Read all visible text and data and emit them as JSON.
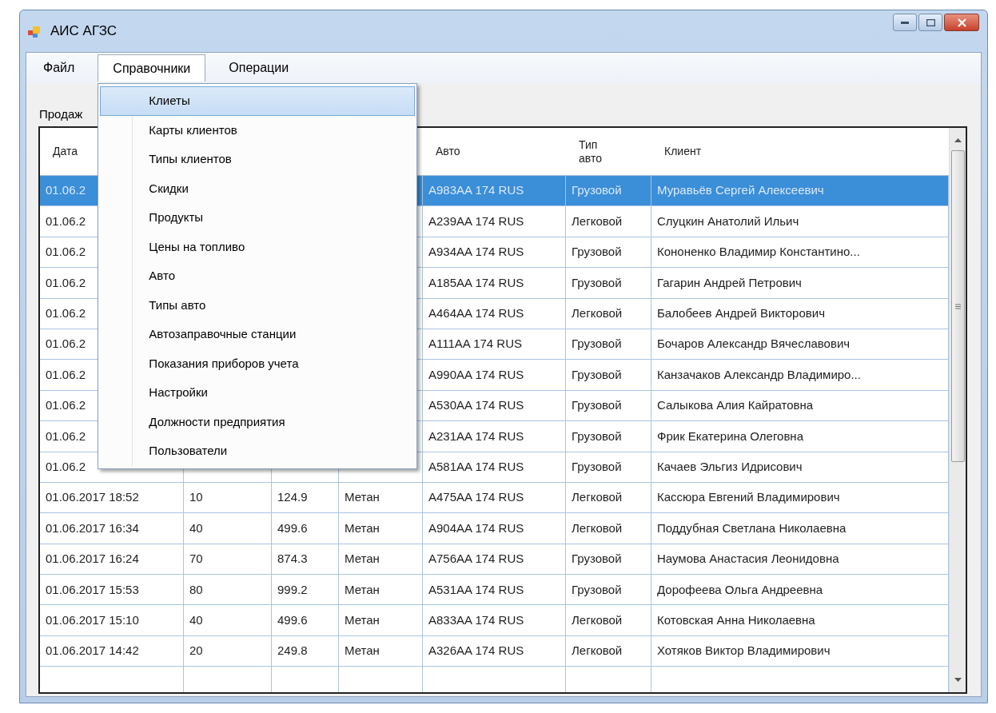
{
  "window": {
    "title": "АИС АГЗС"
  },
  "menu": [
    {
      "label": "Файл",
      "selected": false
    },
    {
      "label": "Справочники",
      "selected": true
    },
    {
      "label": "Операции",
      "selected": false
    }
  ],
  "dropdown": [
    {
      "label": "Клиеты",
      "selected": true
    },
    {
      "label": "Карты клиентов",
      "selected": false
    },
    {
      "label": "Типы клиентов",
      "selected": false
    },
    {
      "label": "Скидки",
      "selected": false
    },
    {
      "label": "Продукты",
      "selected": false
    },
    {
      "label": "Цены на топливо",
      "selected": false
    },
    {
      "label": "Авто",
      "selected": false
    },
    {
      "label": "Типы авто",
      "selected": false
    },
    {
      "label": "Автозаправочные станции",
      "selected": false
    },
    {
      "label": "Показания приборов учета",
      "selected": false
    },
    {
      "label": "Настройки",
      "selected": false
    },
    {
      "label": "Должности предприятия",
      "selected": false
    },
    {
      "label": "Пользователи",
      "selected": false
    }
  ],
  "section_label": "Продаж",
  "table": {
    "columns": {
      "date": "Дата",
      "car": "Авто",
      "car_type": "Тип авто",
      "client": "Клиент"
    },
    "rows": [
      {
        "date": "01.06.2",
        "car": "A983AA 174 RUS",
        "car_type": "Грузовой",
        "client": "Муравьёв Сергей Алексеевич",
        "selected": true
      },
      {
        "date": "01.06.2",
        "car": "A239AA 174 RUS",
        "car_type": "Легковой",
        "client": "Слуцкин Анатолий Ильич",
        "selected": false
      },
      {
        "date": "01.06.2",
        "car": "A934AA 174 RUS",
        "car_type": "Грузовой",
        "client": "Кононенко Владимир Константино...",
        "selected": false
      },
      {
        "date": "01.06.2",
        "car": "A185AA 174 RUS",
        "car_type": "Грузовой",
        "client": "Гагарин Андрей Петрович",
        "selected": false
      },
      {
        "date": "01.06.2",
        "car": "A464AA 174 RUS",
        "car_type": "Легковой",
        "client": "Балобеев Андрей Викторович",
        "selected": false
      },
      {
        "date": "01.06.2",
        "car": "A111AA 174 RUS",
        "car_type": "Грузовой",
        "client": "Бочаров Александр Вячеславович",
        "selected": false
      },
      {
        "date": "01.06.2",
        "car": "A990AA 174 RUS",
        "car_type": "Грузовой",
        "client": "Канзачаков Александр Владимиро...",
        "selected": false
      },
      {
        "date": "01.06.2",
        "car": "A530AA 174 RUS",
        "car_type": "Грузовой",
        "client": "Салыкова Алия Кайратовна",
        "selected": false
      },
      {
        "date": "01.06.2",
        "car": "A231AA 174 RUS",
        "car_type": "Грузовой",
        "client": "Фрик Екатерина Олеговна",
        "selected": false
      },
      {
        "date": "01.06.2",
        "car": "A581AA 174 RUS",
        "car_type": "Грузовой",
        "client": "Качаев Эльгиз Идрисович",
        "selected": false
      },
      {
        "date": "01.06.2017 18:52",
        "column_2": "10",
        "column_3": "124.9",
        "column_4": "Метан",
        "car": "A475AA 174 RUS",
        "car_type": "Легковой",
        "client": "Кассюра Евгений Владимирович",
        "selected": false
      },
      {
        "date": "01.06.2017 16:34",
        "column_2": "40",
        "column_3": "499.6",
        "column_4": "Метан",
        "car": "A904AA 174 RUS",
        "car_type": "Легковой",
        "client": "Поддубная Светлана Николаевна",
        "selected": false
      },
      {
        "date": "01.06.2017 16:24",
        "column_2": "70",
        "column_3": "874.3",
        "column_4": "Метан",
        "car": "A756AA 174 RUS",
        "car_type": "Грузовой",
        "client": "Наумова Анастасия Леонидовна",
        "selected": false
      },
      {
        "date": "01.06.2017 15:53",
        "column_2": "80",
        "column_3": "999.2",
        "column_4": "Метан",
        "car": "A531AA 174 RUS",
        "car_type": "Грузовой",
        "client": "Дорофеева Ольга Андреевна",
        "selected": false
      },
      {
        "date": "01.06.2017 15:10",
        "column_2": "40",
        "column_3": "499.6",
        "column_4": "Метан",
        "car": "A833AA 174 RUS",
        "car_type": "Легковой",
        "client": "Котовская Анна Николаевна",
        "selected": false
      },
      {
        "date": "01.06.2017 14:42",
        "column_2": "20",
        "column_3": "249.8",
        "column_4": "Метан",
        "car": "A326AA 174 RUS",
        "car_type": "Легковой",
        "client": "Хотяков Виктор Владимирович",
        "selected": false
      }
    ]
  }
}
